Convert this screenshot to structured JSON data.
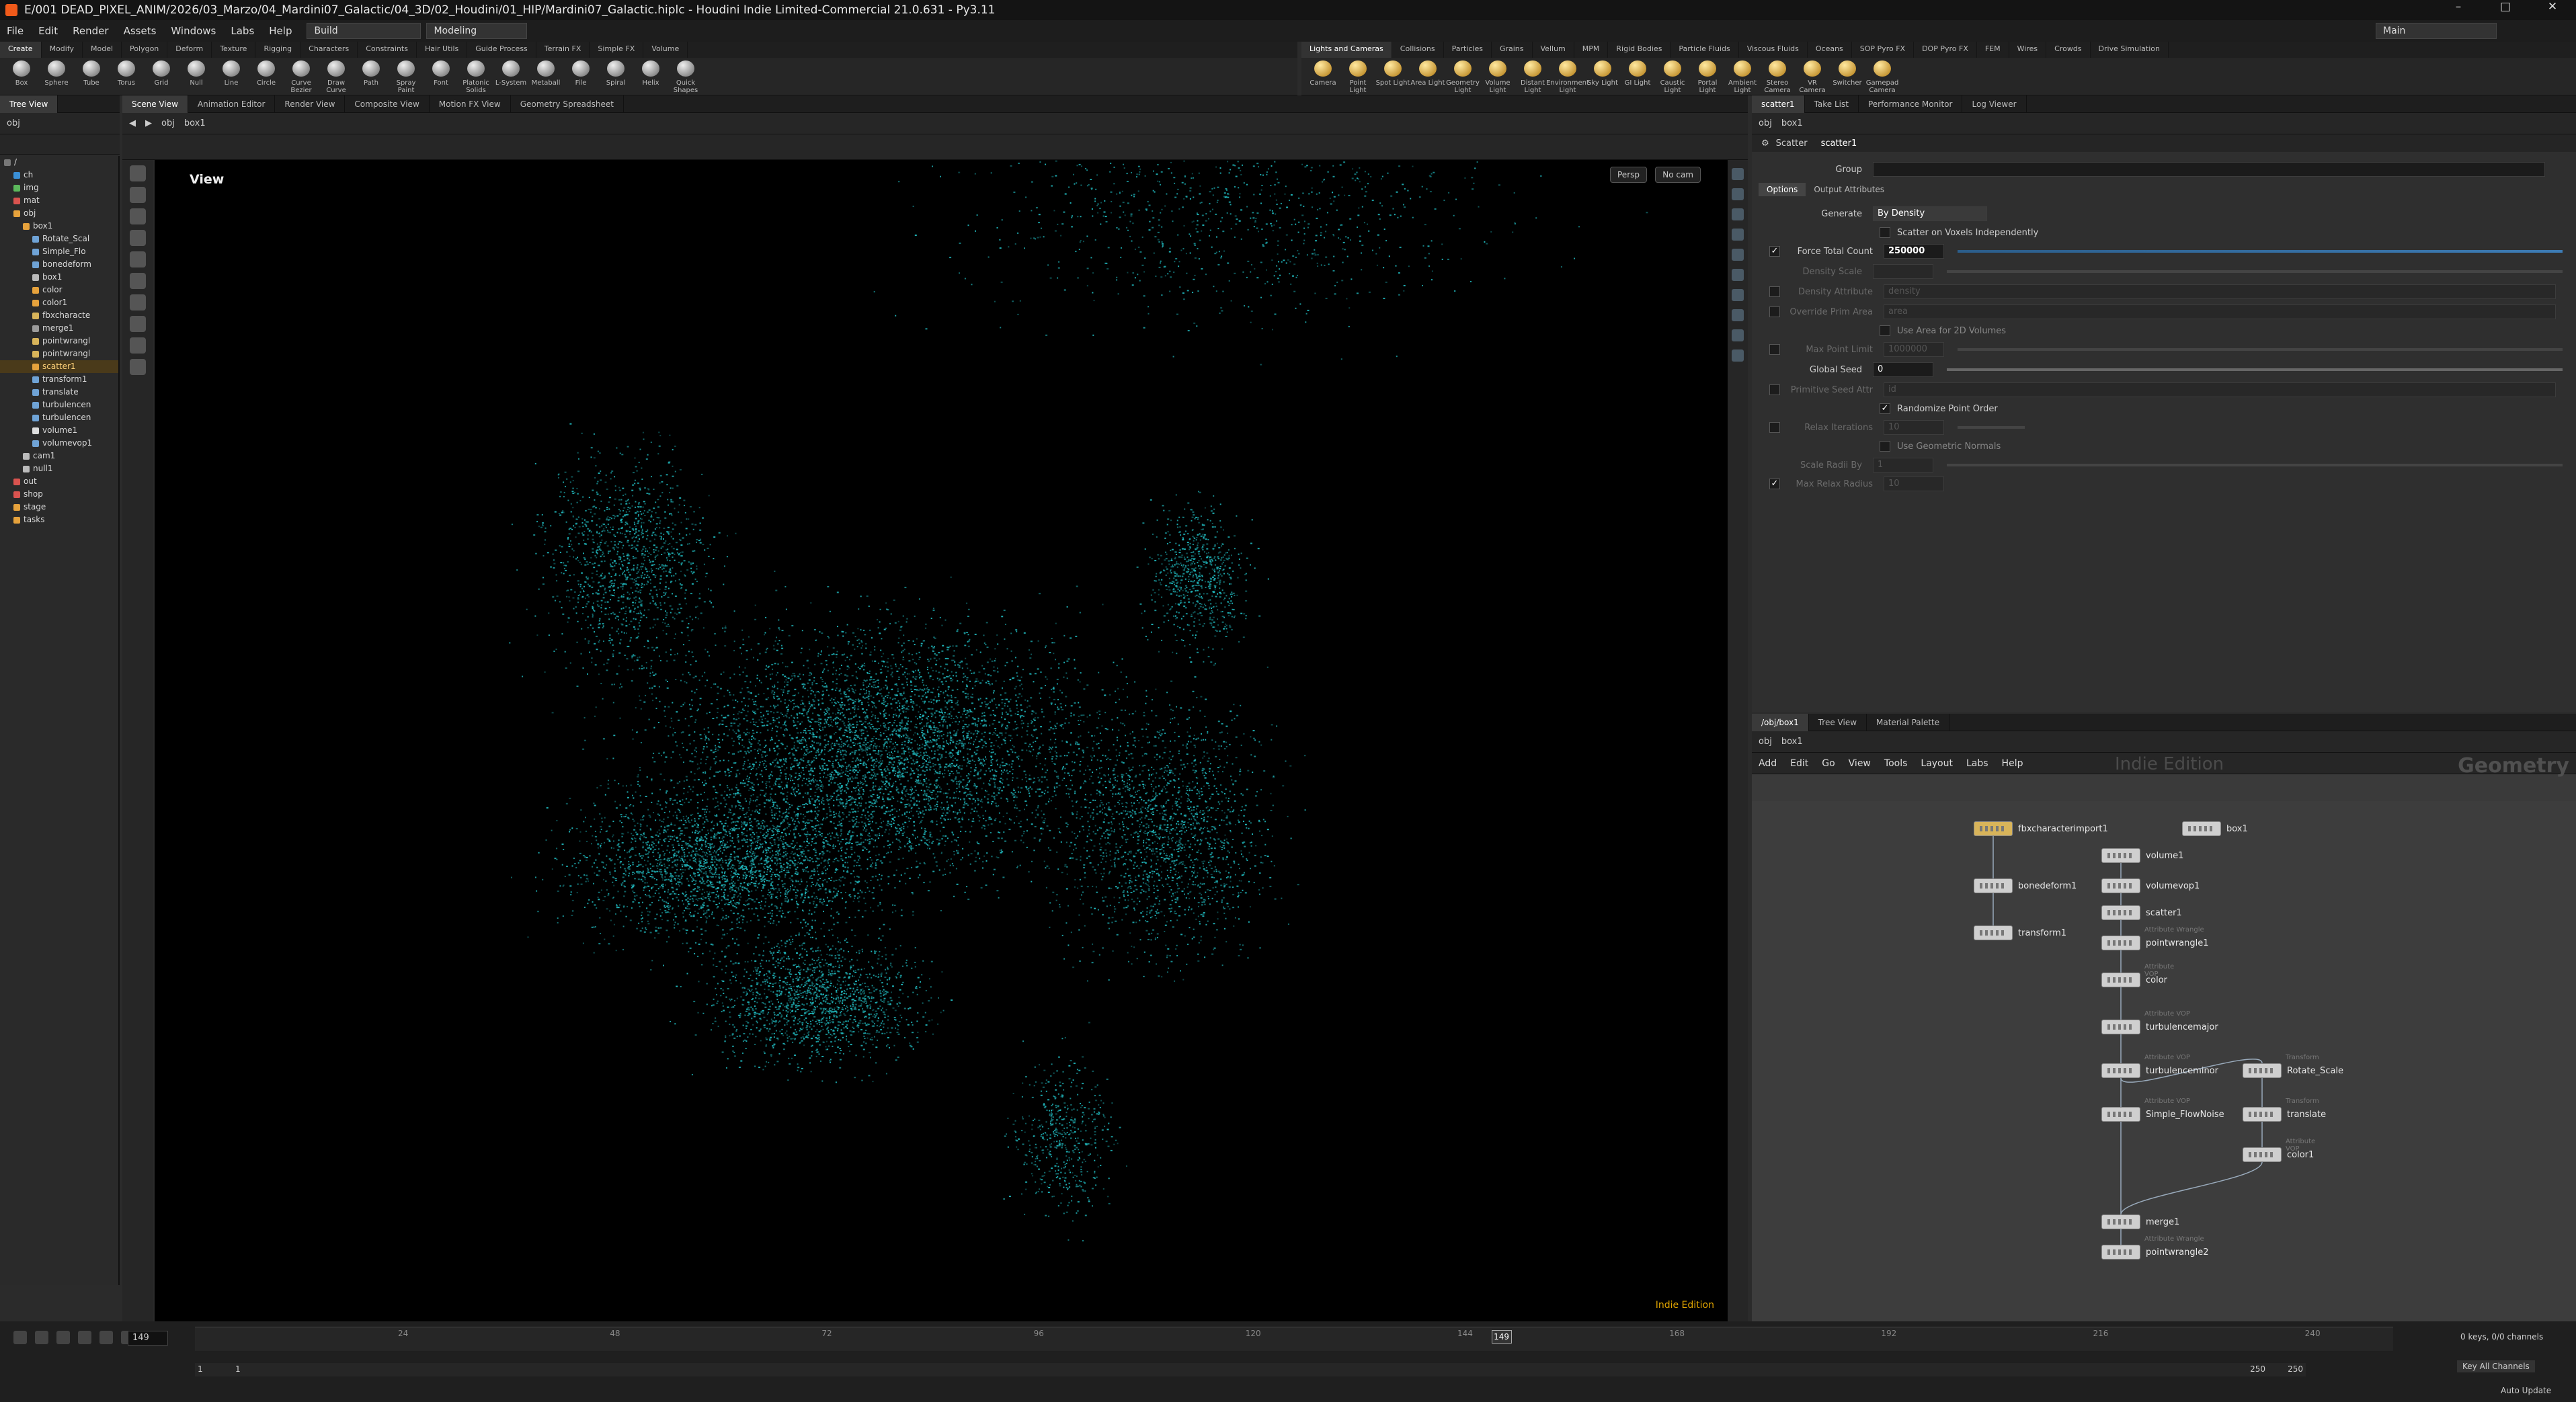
{
  "window": {
    "title": "E/001 DEAD_PIXEL_ANIM/2026/03_Marzo/04_Mardini07_Galactic/04_3D/02_Houdini/01_HIP/Mardini07_Galactic.hiplc - Houdini Indie Limited-Commercial 21.0.631 - Py3.11"
  },
  "menu": [
    "File",
    "Edit",
    "Render",
    "Assets",
    "Windows",
    "Labs",
    "Help"
  ],
  "desktop": {
    "build": "Build",
    "modeling": "Modeling",
    "main": "Main"
  },
  "shelf_tabs_left": [
    "Create",
    "Modify",
    "Model",
    "Polygon",
    "Deform",
    "Texture",
    "Rigging",
    "Characters",
    "Constraints",
    "Hair Utils",
    "Guide Process",
    "Terrain FX",
    "Simple FX",
    "Volume"
  ],
  "shelf_tabs_right": [
    "Lights and Cameras",
    "Collisions",
    "Particles",
    "Grains",
    "Vellum",
    "MPM",
    "Rigid Bodies",
    "Particle Fluids",
    "Viscous Fluids",
    "Oceans",
    "SOP Pyro FX",
    "DOP Pyro FX",
    "FEM",
    "Wires",
    "Crowds",
    "Drive Simulation"
  ],
  "tools_left": [
    "Box",
    "Sphere",
    "Tube",
    "Torus",
    "Grid",
    "Null",
    "Line",
    "Circle",
    "Curve Bezier",
    "Draw Curve",
    "Path",
    "Spray Paint",
    "Font",
    "Platonic Solids",
    "L-System",
    "Metaball",
    "File",
    "Spiral",
    "Helix",
    "Quick Shapes"
  ],
  "tools_right": [
    "Camera",
    "Point Light",
    "Spot Light",
    "Area Light",
    "Geometry Light",
    "Volume Light",
    "Distant Light",
    "Environment Light",
    "Sky Light",
    "GI Light",
    "Caustic Light",
    "Portal Light",
    "Ambient Light",
    "Stereo Camera",
    "VR Camera",
    "Switcher",
    "Gamepad Camera"
  ],
  "left_panebar": {
    "tab": "Tree View"
  },
  "center_panebar": [
    "Scene View",
    "Animation Editor",
    "Render View",
    "Composite View",
    "Motion FX View",
    "Geometry Spreadsheet"
  ],
  "path": {
    "obj": "obj",
    "node": "box1"
  },
  "tree": [
    "/",
    "ch",
    "img",
    "mat",
    "obj",
    "box1",
    "Rotate_Scal",
    "Simple_Flo",
    "bonedeform",
    "box1",
    "color",
    "color1",
    "fbxcharacte",
    "merge1",
    "pointwrangl",
    "pointwrangl",
    "scatter1",
    "transform1",
    "translate",
    "turbulencen",
    "turbulencen",
    "volume1",
    "volumevop1",
    "cam1",
    "null1",
    "out",
    "shop",
    "stage",
    "tasks"
  ],
  "tree_selected_index": 16,
  "viewport": {
    "label": "View",
    "persp": "Persp",
    "cam": "No cam",
    "indie": "Indie Edition"
  },
  "right_panebar": [
    "scatter1",
    "Take List",
    "Performance Monitor",
    "Log Viewer"
  ],
  "params": {
    "node_type": "Scatter",
    "node_name": "scatter1",
    "group_label": "Group",
    "tabs": [
      "Options",
      "Output Attributes"
    ],
    "generate_label": "Generate",
    "generate_value": "By Density",
    "scatter_voxels": "Scatter on Voxels Independently",
    "force_total_label": "Force Total Count",
    "force_total_value": "250000",
    "density_scale": "Density Scale",
    "density_attr": "Density Attribute",
    "density_attr_value": "density",
    "override_prim": "Override Prim Area",
    "override_prim_value": "area",
    "use_area": "Use Area for 2D Volumes",
    "max_point": "Max Point Limit",
    "max_point_value": "1000000",
    "global_seed": "Global Seed",
    "global_seed_value": "0",
    "prim_seed": "Primitive Seed Attr",
    "prim_seed_value": "id",
    "randomize": "Randomize Point Order",
    "relax": "Relax Iterations",
    "relax_value": "10",
    "geo_normals": "Use Geometric Normals",
    "scale_radii": "Scale Radii By",
    "scale_radii_value": "1",
    "max_relax": "Max Relax Radius",
    "max_relax_value": "10"
  },
  "net_panebar": [
    "/obj/box1",
    "Tree View",
    "Material Palette"
  ],
  "net_menu": [
    "Add",
    "Edit",
    "Go",
    "View",
    "Tools",
    "Layout",
    "Labs",
    "Help"
  ],
  "net_watermark": {
    "indie": "Indie Edition",
    "geo": "Geometry"
  },
  "nodes": [
    {
      "name": "fbxcharacterimport1",
      "type": ""
    },
    {
      "name": "box1",
      "type": ""
    },
    {
      "name": "volume1",
      "type": ""
    },
    {
      "name": "bonedeform1",
      "type": ""
    },
    {
      "name": "volumevop1",
      "type": ""
    },
    {
      "name": "transform1",
      "type": ""
    },
    {
      "name": "scatter1",
      "type": ""
    },
    {
      "name": "pointwrangle1",
      "type": "Attribute Wrangle"
    },
    {
      "name": "color",
      "type": "Attribute VOP"
    },
    {
      "name": "turbulencemajor",
      "type": "Attribute VOP"
    },
    {
      "name": "turbulenceminor",
      "type": "Attribute VOP"
    },
    {
      "name": "Rotate_Scale",
      "type": "Transform"
    },
    {
      "name": "Simple_FlowNoise",
      "type": "Attribute VOP"
    },
    {
      "name": "translate",
      "type": "Transform"
    },
    {
      "name": "color1",
      "type": "Attribute VOP"
    },
    {
      "name": "merge1",
      "type": ""
    },
    {
      "name": "pointwrangle2",
      "type": "Attribute Wrangle"
    }
  ],
  "timeline": {
    "ticks": [
      "24",
      "48",
      "72",
      "96",
      "120",
      "144",
      "168",
      "192",
      "216",
      "240"
    ],
    "current": "149",
    "frame_field": "149",
    "start": "1",
    "start2": "1",
    "end": "250",
    "end2": "250",
    "keys": "0 keys, 0/0 channels",
    "key_all": "Key All Channels",
    "auto_update": "Auto Update"
  },
  "colors": {
    "points": "#1fb3b8",
    "accent": "#e0a400",
    "background": "#000000"
  }
}
